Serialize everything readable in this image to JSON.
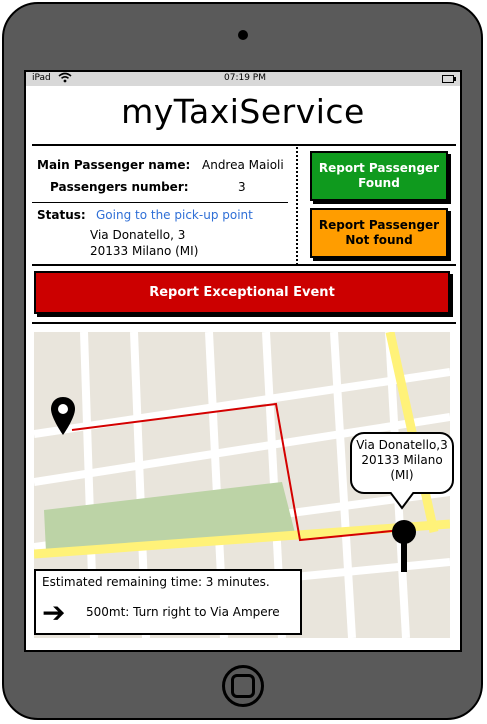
{
  "statusbar": {
    "device": "iPad",
    "time": "07:19 PM"
  },
  "app": {
    "title": "myTaxiService"
  },
  "info": {
    "main_passenger_label": "Main Passenger name:",
    "main_passenger_value": "Andrea Maioli",
    "passengers_label": "Passengers number:",
    "passengers_value": "3",
    "status_label": "Status:",
    "status_value": "Going to the pick-up point",
    "address_line1": "Via Donatello, 3",
    "address_line2": "20133 Milano (MI)"
  },
  "buttons": {
    "found": [
      "Report Passenger",
      "Found"
    ],
    "not_found": [
      "Report Passenger",
      "Not found"
    ],
    "exceptional": "Report Exceptional Event"
  },
  "map": {
    "callout": [
      "Via Donatello,3",
      "20133 Milano",
      "(MI)"
    ]
  },
  "navigation": {
    "eta": "Estimated remaining time: 3 minutes.",
    "instruction": "500mt:  Turn right to Via Ampere",
    "direction_icon": "arrow-right-icon"
  },
  "colors": {
    "found_button": "#0f9a1e",
    "not_found_button": "#ff9d00",
    "exceptional_button": "#cc0000",
    "status_text": "#2f6fd6",
    "route": "#d40000"
  }
}
